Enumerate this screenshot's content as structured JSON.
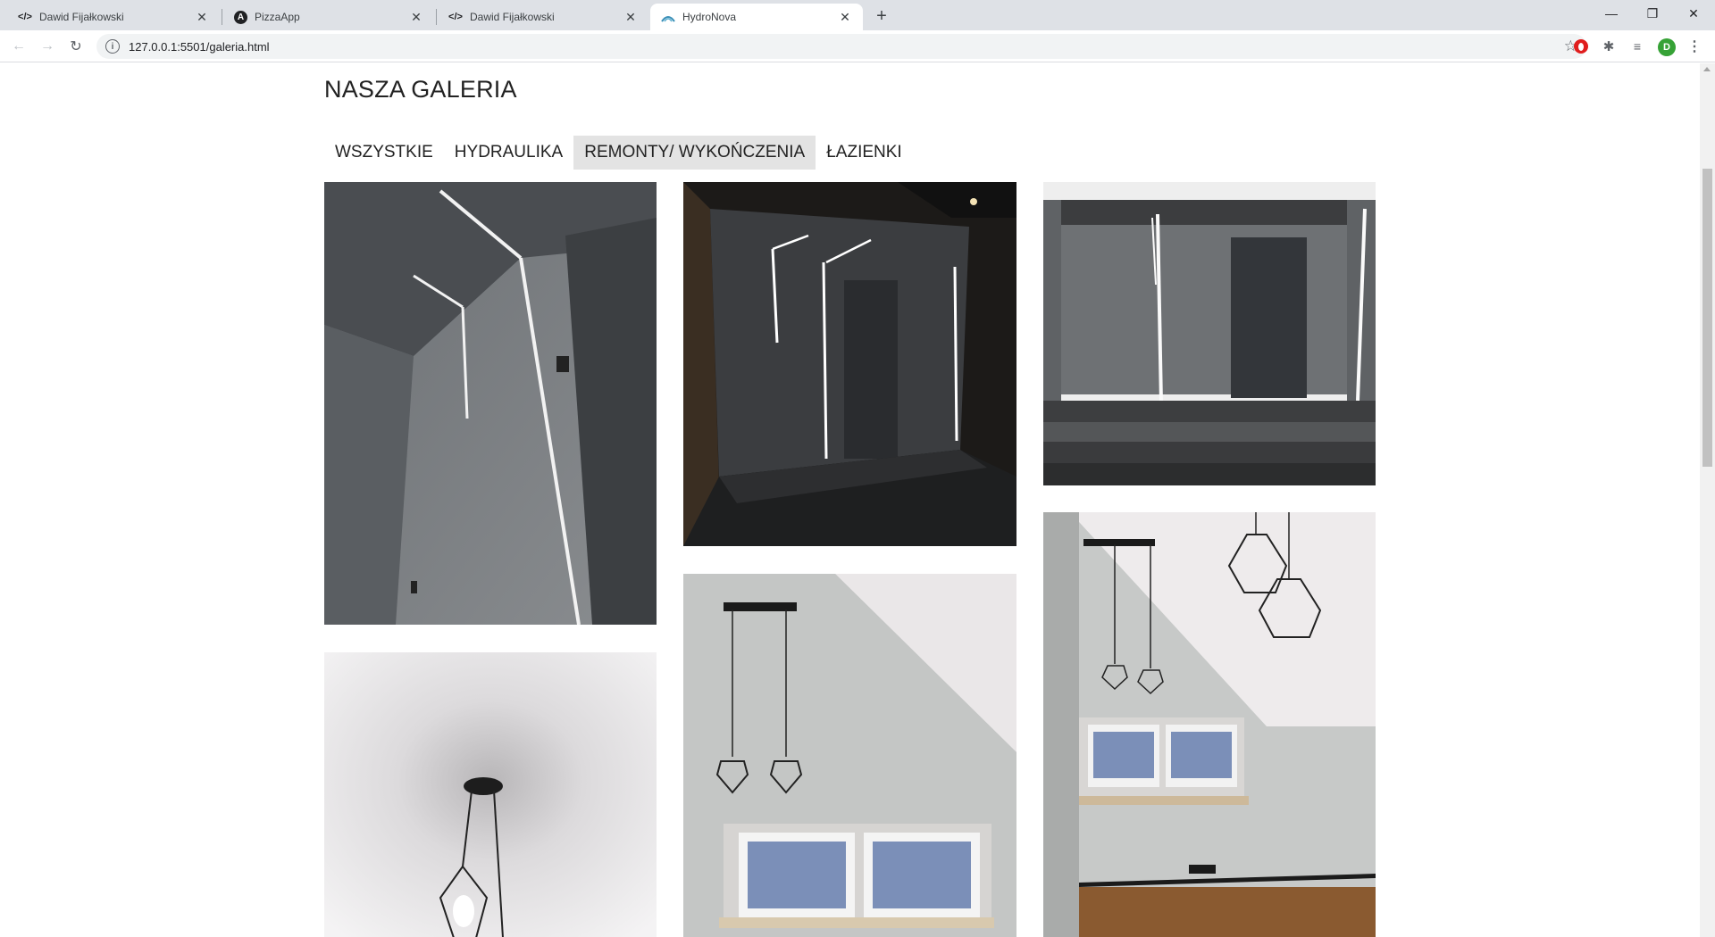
{
  "browser": {
    "tabs": [
      {
        "title": "Dawid Fijałkowski",
        "favicon": "code-icon"
      },
      {
        "title": "PizzaApp",
        "favicon": "angular-icon"
      },
      {
        "title": "Dawid Fijałkowski",
        "favicon": "code-icon"
      },
      {
        "title": "HydroNova",
        "favicon": "hydronova-icon"
      }
    ],
    "active_tab": 3,
    "url": "127.0.0.1:5501/galeria.html",
    "profile_initial": "D"
  },
  "page": {
    "title": "NASZA GALERIA",
    "filters": [
      {
        "label": "WSZYSTKIE"
      },
      {
        "label": "HYDRAULIKA"
      },
      {
        "label": "REMONTY/ WYKOŃCZENIA"
      },
      {
        "label": "ŁAZIENKI"
      }
    ],
    "active_filter": 2,
    "gallery": [
      {
        "subject": "concrete entrance wall with led light lines"
      },
      {
        "subject": "entrance door with led lines at night"
      },
      {
        "subject": "concrete entrance with steps and led lines"
      },
      {
        "subject": "pendant lamp from below"
      },
      {
        "subject": "room with pendant lamps and window"
      },
      {
        "subject": "attic room with cage pendant lamps"
      }
    ]
  },
  "colors": {
    "tabstrip_bg": "#dee1e6",
    "active_filter_bg": "#e3e3e3",
    "text": "#222222"
  }
}
